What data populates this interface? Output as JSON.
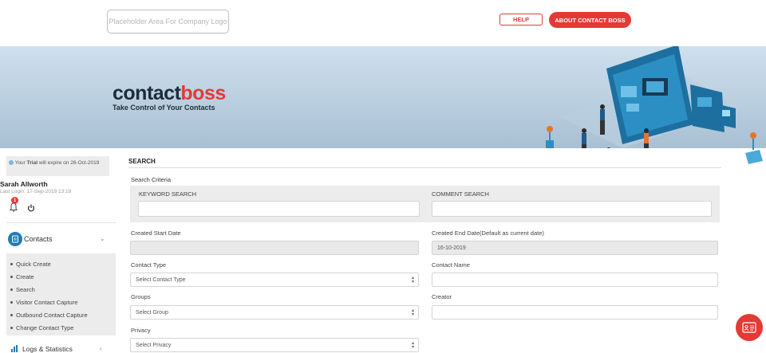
{
  "header": {
    "logo_placeholder": "Placeholder Area For Company Logo",
    "help_label": "HELP",
    "about_label": "ABOUT CONTACT BOSS"
  },
  "banner": {
    "brand_part1": "contact",
    "brand_part2": "boss",
    "tagline": "Take Control of Your Contacts"
  },
  "sidebar": {
    "trial_prefix": "Your ",
    "trial_bold": "Trial",
    "trial_suffix": " will expire on 26-Oct-2019",
    "user_name": "Sarah Allworth",
    "last_login": "Last Login: 17-Sep-2019 13:19",
    "notification_count": "1",
    "contacts_label": "Contacts",
    "submenu": [
      {
        "label": "Quick Create"
      },
      {
        "label": "Create"
      },
      {
        "label": "Search"
      },
      {
        "label": "Visitor Contact Capture"
      },
      {
        "label": "Outbound Contact Capture"
      },
      {
        "label": "Change Contact Type"
      }
    ],
    "logs_label": "Logs & Statistics"
  },
  "search": {
    "title": "SEARCH",
    "criteria_label": "Search Criteria",
    "keyword_label": "KEYWORD SEARCH",
    "keyword_value": "",
    "comment_label": "COMMENT SEARCH",
    "comment_value": "",
    "created_start_label": "Created Start Date",
    "created_start_value": "",
    "created_end_label": "Created End Date(Default as current date)",
    "created_end_value": "16-10-2019",
    "contact_type_label": "Contact Type",
    "contact_type_value": "Select Contact Type",
    "contact_name_label": "Contact Name",
    "contact_name_value": "",
    "groups_label": "Groups",
    "groups_value": "Select Group",
    "creator_label": "Creator",
    "creator_value": "",
    "privacy_label": "Privacy",
    "privacy_value": "Select Privacy"
  },
  "colors": {
    "accent": "#e53935",
    "brand_dark": "#1d2c3b",
    "primary_blue": "#1e7cb6"
  },
  "icons": [
    "info-icon",
    "bell-icon",
    "power-icon",
    "contacts-book-icon",
    "chevron-down-icon",
    "bar-chart-icon",
    "chevron-left-icon",
    "contact-card-icon"
  ]
}
